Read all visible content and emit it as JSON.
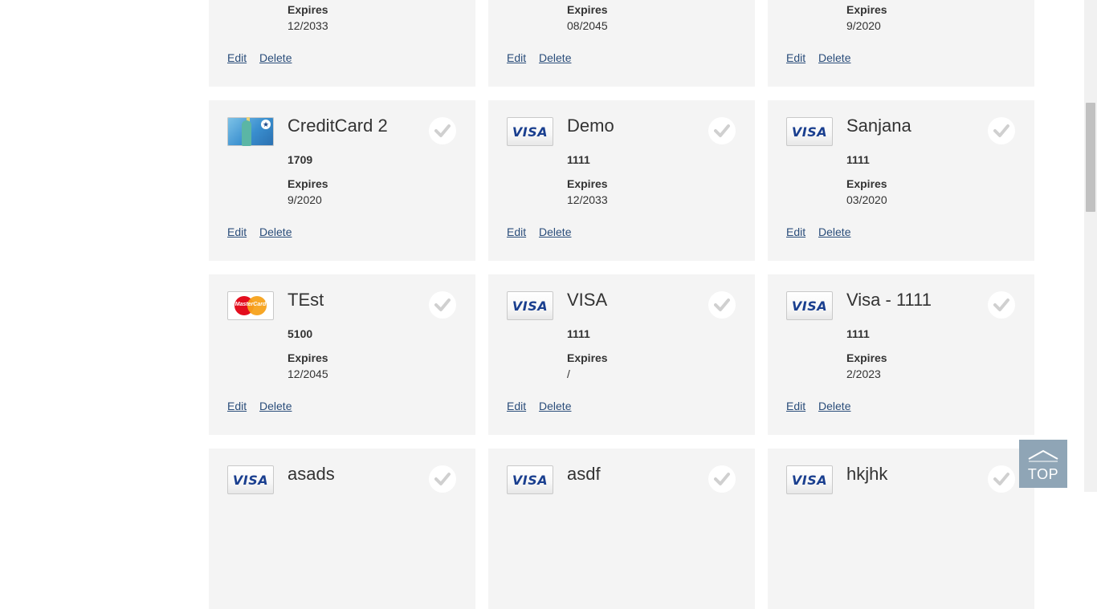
{
  "cards_row0": [
    {
      "expires_label": "Expires",
      "expires": "12/2033",
      "edit": "Edit",
      "delete": "Delete"
    },
    {
      "expires_label": "Expires",
      "expires": "08/2045",
      "edit": "Edit",
      "delete": "Delete"
    },
    {
      "expires_label": "Expires",
      "expires": "9/2020",
      "edit": "Edit",
      "delete": "Delete"
    }
  ],
  "cards_row1": [
    {
      "name": "CreditCard 2",
      "digits": "1709",
      "expires_label": "Expires",
      "expires": "9/2020",
      "edit": "Edit",
      "delete": "Delete",
      "logo": "liberty"
    },
    {
      "name": "Demo",
      "digits": "1111",
      "expires_label": "Expires",
      "expires": "12/2033",
      "edit": "Edit",
      "delete": "Delete",
      "logo": "visa"
    },
    {
      "name": "Sanjana",
      "digits": "1111",
      "expires_label": "Expires",
      "expires": "03/2020",
      "edit": "Edit",
      "delete": "Delete",
      "logo": "visa"
    }
  ],
  "cards_row2": [
    {
      "name": "TEst",
      "digits": "5100",
      "expires_label": "Expires",
      "expires": "12/2045",
      "edit": "Edit",
      "delete": "Delete",
      "logo": "mastercard"
    },
    {
      "name": "VISA",
      "digits": "1111",
      "expires_label": "Expires",
      "expires": "/",
      "edit": "Edit",
      "delete": "Delete",
      "logo": "visa"
    },
    {
      "name": "Visa - 1111",
      "digits": "1111",
      "expires_label": "Expires",
      "expires": "2/2023",
      "edit": "Edit",
      "delete": "Delete",
      "logo": "visa"
    }
  ],
  "cards_row3": [
    {
      "name": "asads",
      "logo": "visa"
    },
    {
      "name": "asdf",
      "logo": "visa"
    },
    {
      "name": "hkjhk",
      "logo": "visa"
    }
  ],
  "visa_text": "VISA",
  "mastercard_text": "MasterCard",
  "top_button": {
    "label": "TOP"
  },
  "colors": {
    "card_bg": "#f4f4f4",
    "link": "#2a4d7a",
    "top_button_bg": "#8fa5b6",
    "visa_blue": "#1a3f8f"
  }
}
